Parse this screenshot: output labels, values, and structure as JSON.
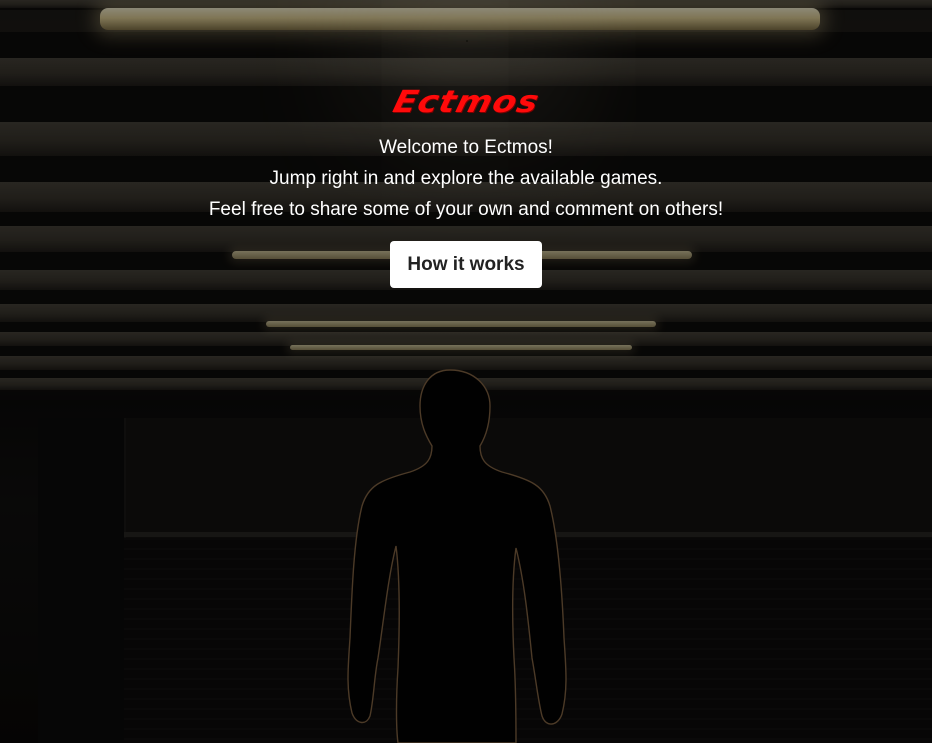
{
  "brand": {
    "logo_text": "Ectmos",
    "logo_color": "#ff0a0a"
  },
  "hero": {
    "lines": [
      "Welcome to Ectmos!",
      "Jump right in and explore the available games.",
      "Feel free to share some of your own and comment on others!"
    ],
    "cta_label": "How it works"
  },
  "background": {
    "icon": "silhouette-under-ceiling-lights-image",
    "overlay_color": "#000000"
  }
}
